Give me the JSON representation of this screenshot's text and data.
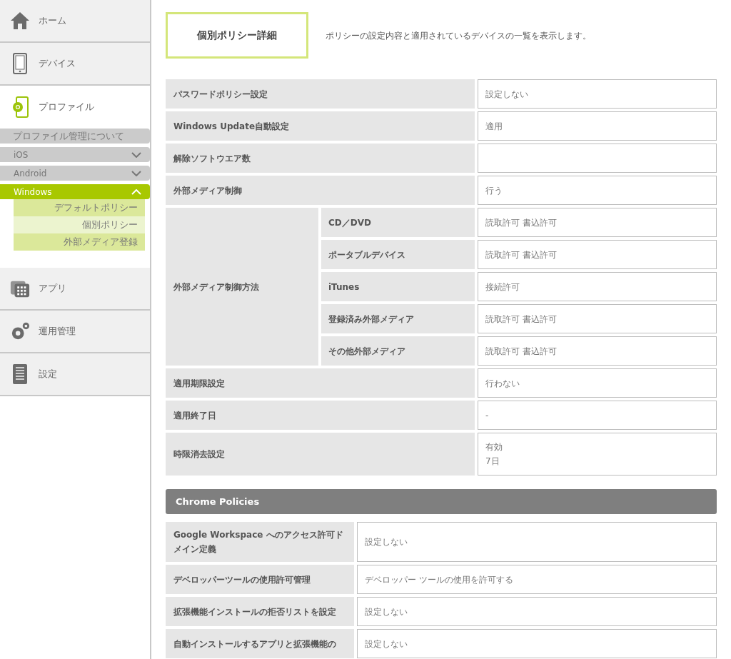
{
  "sidebar": {
    "items": [
      {
        "label": "ホーム",
        "kind": "home",
        "selected": false
      },
      {
        "label": "デバイス",
        "kind": "device",
        "selected": false
      },
      {
        "label": "プロファイル",
        "kind": "profile",
        "selected": true,
        "children": [
          {
            "label": "プロファイル管理について",
            "kind": "link"
          },
          {
            "label": "iOS",
            "kind": "group",
            "expanded": false
          },
          {
            "label": "Android",
            "kind": "group",
            "expanded": false
          },
          {
            "label": "Windows",
            "kind": "group",
            "expanded": true,
            "children": [
              {
                "label": "デフォルトポリシー",
                "selected": false
              },
              {
                "label": "個別ポリシー",
                "selected": true
              },
              {
                "label": "外部メディア登録",
                "selected": false
              }
            ]
          }
        ]
      },
      {
        "label": "アプリ",
        "kind": "apps",
        "selected": false
      },
      {
        "label": "運用管理",
        "kind": "gears",
        "selected": false
      },
      {
        "label": "設定",
        "kind": "document",
        "selected": false
      }
    ]
  },
  "heading": {
    "title": "個別ポリシー詳細",
    "description": "ポリシーの設定内容と適用されているデバイスの一覧を表示します。"
  },
  "policy_table": {
    "rows": [
      {
        "label": "パスワードポリシー設定",
        "value": "設定しない"
      },
      {
        "label": "Windows Update自動設定",
        "value": "適用"
      },
      {
        "label": "解除ソフトウエア数"
      },
      {
        "label": "外部メディア制御",
        "value": "行う"
      },
      {
        "label": "外部メディア制御方法",
        "children": [
          {
            "label": "CD／DVD",
            "value": "読取許可 書込許可"
          },
          {
            "label": "ポータブルデバイス",
            "value": "読取許可 書込許可"
          },
          {
            "label": "iTunes",
            "value": "接続許可"
          },
          {
            "label": "登録済み外部メディア",
            "value": "読取許可 書込許可"
          },
          {
            "label": "その他外部メディア",
            "value": "読取許可 書込許可"
          }
        ]
      },
      {
        "label": "適用期限設定",
        "value": "行わない"
      },
      {
        "label": "適用終了日",
        "value": "-"
      },
      {
        "label": "時限消去設定",
        "lines": [
          "有効",
          "7日"
        ]
      }
    ]
  },
  "chrome_policies": {
    "title": "Chrome Policies",
    "rows": [
      {
        "label": "Google Workspace へのアクセス許可ドメイン定義",
        "value": "設定しない"
      },
      {
        "label": "デベロッパーツールの使用許可管理",
        "value": "デベロッパー ツールの使用を許可する"
      },
      {
        "label": "拡張機能インストールの拒否リストを設定",
        "value": "設定しない"
      },
      {
        "label": "自動インストールするアプリと拡張機能の",
        "value": "設定しない"
      }
    ]
  }
}
